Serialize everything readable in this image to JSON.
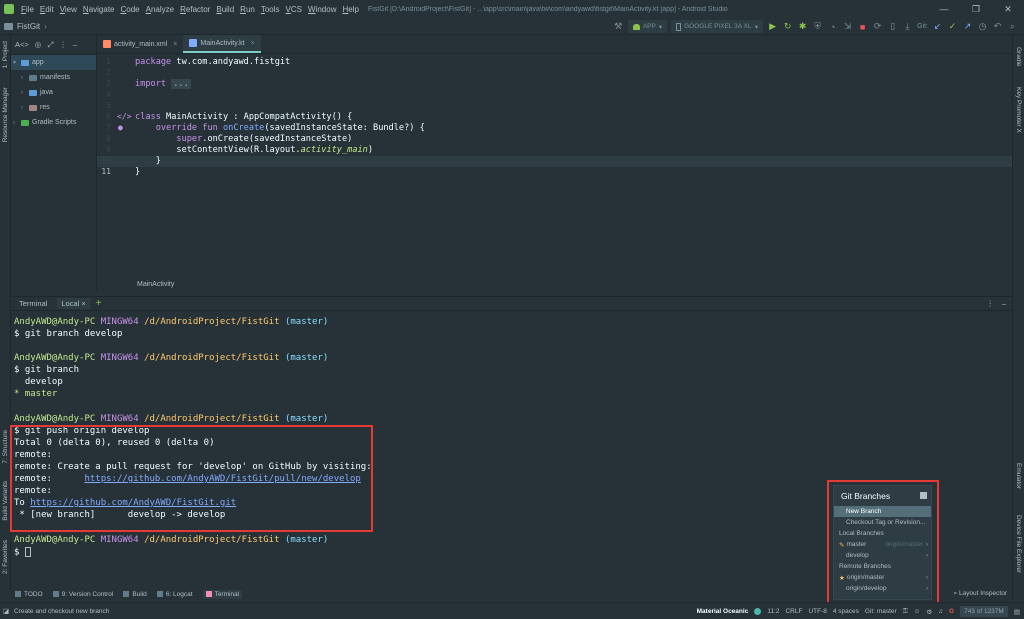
{
  "menubar": {
    "items": [
      "File",
      "Edit",
      "View",
      "Navigate",
      "Code",
      "Analyze",
      "Refactor",
      "Build",
      "Run",
      "Tools",
      "VCS",
      "Window",
      "Help"
    ],
    "window_title": "FistGit [D:\\AndroidProject\\FistGit] - ...\\app\\src\\main\\java\\tw\\com\\andyawd\\fistgit\\MainActivity.kt [app] - Android Studio",
    "win_ctrls": [
      "—",
      "❐",
      "✕"
    ]
  },
  "navbar": {
    "project": "FistGit",
    "run_config": "APP",
    "device": "GOOGLE PIXEL 3A XL",
    "git_label": "Git:"
  },
  "left_strip": {
    "project": "1: Project",
    "resource_manager": "Resource Manager",
    "structure": "7: Structure",
    "build_variants": "Build Variants",
    "favorites": "2: Favorites"
  },
  "right_strip": {
    "gradle": "Gradle",
    "key_promoter": "Key Promoter X",
    "emulator": "Emulator",
    "device_file_explorer": "Device File Explorer"
  },
  "project_panel": {
    "view_selector": "A<>",
    "tree": [
      {
        "label": "app",
        "level": 0
      },
      {
        "label": "manifests",
        "level": 1
      },
      {
        "label": "java",
        "level": 1
      },
      {
        "label": "res",
        "level": 1
      },
      {
        "label": "Gradle Scripts",
        "level": 0
      }
    ]
  },
  "editor": {
    "tabs": [
      {
        "label": "activity_main.xml",
        "active": false
      },
      {
        "label": "MainActivity.kt",
        "active": true
      }
    ],
    "line_numbers": [
      "1",
      "2",
      "3",
      "4",
      "5",
      "6",
      "7",
      "8",
      "9",
      "10",
      "11"
    ],
    "lines": {
      "l1_kw": "package ",
      "l1_rest": "tw.com.andyawd.fistgit",
      "l3_kw": "import ",
      "l3_fold": "...",
      "l6_kw": "class ",
      "l6_rest": "MainActivity : AppCompatActivity() {",
      "l7_kw": "override fun ",
      "l7_fn": "onCreate",
      "l7_rest": "(savedInstanceState: Bundle?) {",
      "l8_kw": "super",
      "l8_rest": ".onCreate(savedInstanceState)",
      "l9_a": "setContentView(R.layout.",
      "l9_it": "activity_main",
      "l9_b": ")",
      "l10": "}",
      "l11": "}"
    },
    "breadcrumb": "MainActivity"
  },
  "terminal": {
    "tabs": [
      "Terminal",
      "Local"
    ],
    "add": "+",
    "prompt_user": "AndyAWD@Andy-PC",
    "prompt_env": "MINGW64",
    "prompt_path": "/d/AndroidProject/FistGit",
    "prompt_branch": "(master)",
    "cmd1": "$ git branch develop",
    "cmd2": "$ git branch",
    "out2a": "  develop",
    "out2b": "* master",
    "cmd3": "$ git push origin develop",
    "out3_1": "Total 0 (delta 0), reused 0 (delta 0)",
    "out3_2": "remote:",
    "out3_3": "remote: Create a pull request for 'develop' on GitHub by visiting:",
    "out3_4a": "remote:      ",
    "out3_4b": "https://github.com/AndyAWD/FistGit/pull/new/develop",
    "out3_5": "remote:",
    "out3_6a": "To ",
    "out3_6b": "https://github.com/AndyAWD/FistGit.git",
    "out3_7": " * [new branch]      develop -> develop",
    "cmd4": "$ "
  },
  "toolwindows": {
    "todo": "TODO",
    "vcs": "9: Version Control",
    "build": "Build",
    "logcat": "6: Logcat",
    "terminal": "Terminal",
    "layout_inspector": "Layout Inspector"
  },
  "git_popup": {
    "title": "Git Branches",
    "new_branch": "New Branch",
    "checkout": "Checkout Tag or Revision...",
    "local_header": "Local Branches",
    "local": [
      {
        "name": "master",
        "tracking": "origin/master"
      },
      {
        "name": "develop",
        "tracking": ""
      }
    ],
    "remote_header": "Remote Branches",
    "remote": [
      {
        "name": "origin/master"
      },
      {
        "name": "origin/develop"
      }
    ]
  },
  "statusbar": {
    "message": "Create and checkout new branch",
    "theme": "Material Oceanic",
    "position": "11:2",
    "line_sep": "CRLF",
    "encoding": "UTF-8",
    "indent": "4 spaces",
    "git": "Git: master",
    "memory": "743 of 1237M"
  }
}
